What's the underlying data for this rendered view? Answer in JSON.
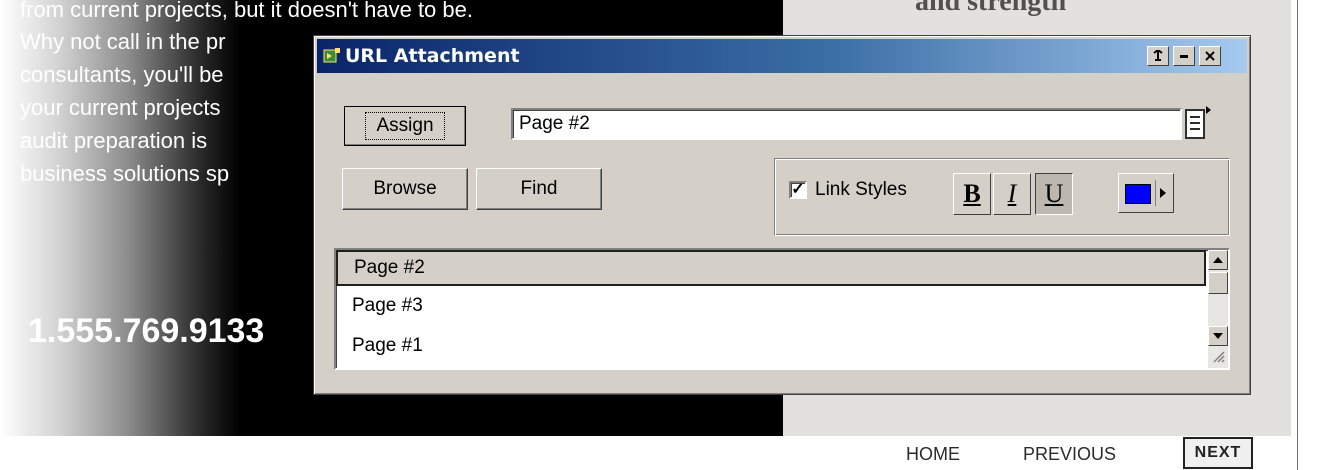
{
  "background_page": {
    "text_lines": [
      "from current projects, but it doesn't have to be.",
      "Why not call in the pr",
      "consultants, you'll be",
      "your current projects",
      "audit preparation is",
      "business solutions sp"
    ],
    "phone": "1.555.769.9133",
    "heading": "and strength",
    "nav": {
      "home": "HOME",
      "previous": "PREVIOUS",
      "next": "NEXT"
    }
  },
  "dialog": {
    "title": "URL Attachment",
    "titlebar_buttons": {
      "help": "t",
      "minimize": "-",
      "close": "x"
    },
    "assign_label": "Assign",
    "browse_label": "Browse",
    "find_label": "Find",
    "url_value": "Page #2",
    "link_styles": {
      "label": "Link Styles",
      "checked": true,
      "bold": "B",
      "italic": "I",
      "underline": "U",
      "color": "#0000ff"
    },
    "list_items": [
      "Page #2",
      "Page #3",
      "Page #1"
    ],
    "selected_index": 0
  },
  "colors": {
    "titlebar_start": "#0a246a",
    "titlebar_end": "#a6caf0",
    "dialog_face": "#d4d0c8"
  }
}
